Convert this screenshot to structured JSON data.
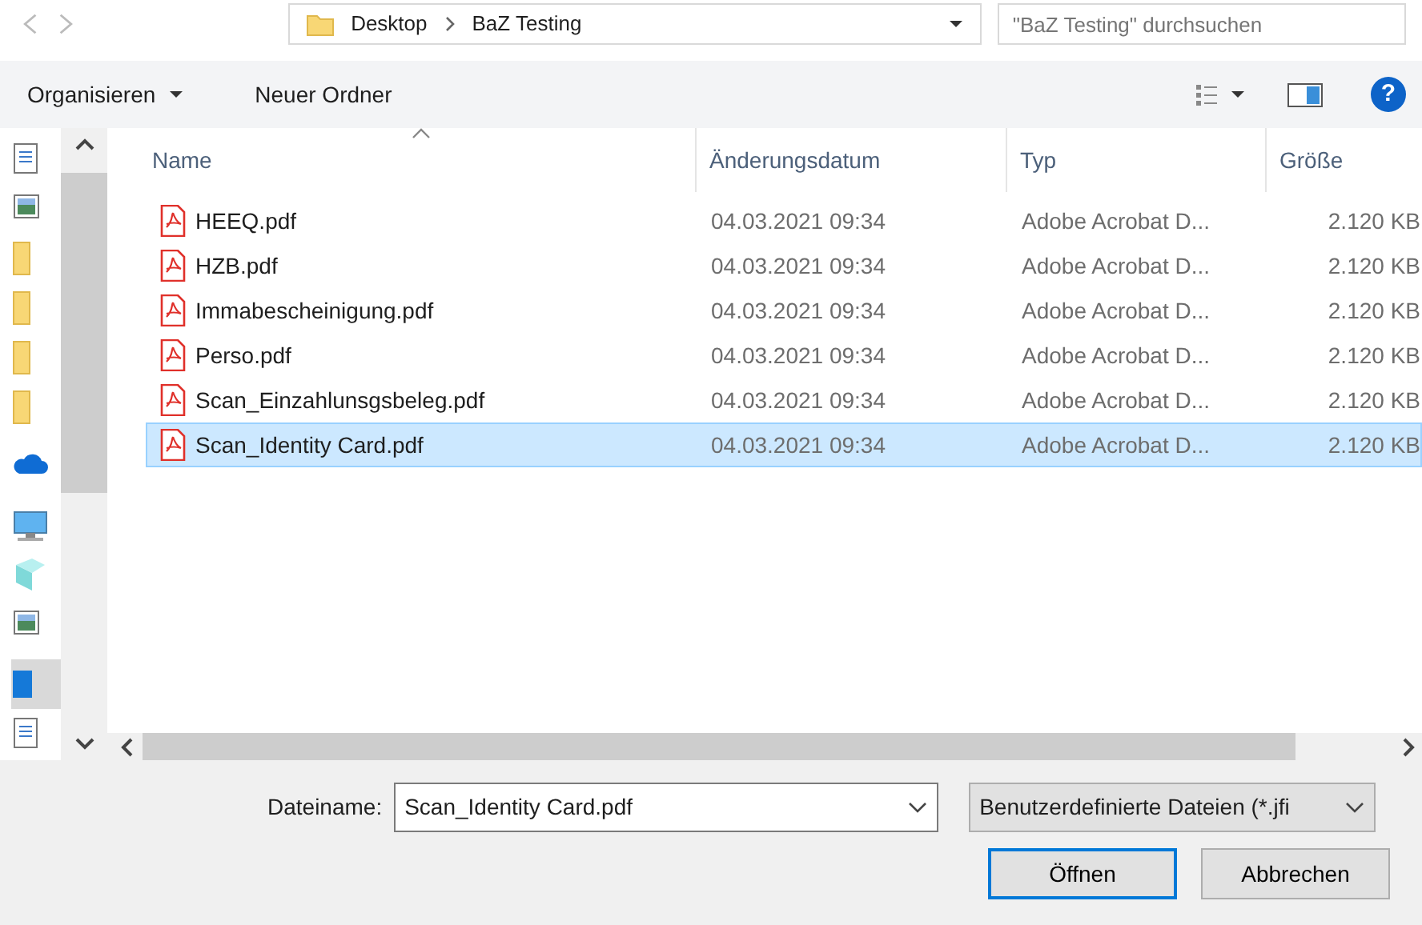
{
  "address_bar": {
    "crumbs": [
      "Desktop",
      "BaZ Testing"
    ]
  },
  "search": {
    "placeholder": "\"BaZ Testing\" durchsuchen"
  },
  "toolbar": {
    "buttons": [
      "Organisieren",
      "Neuer Ordner"
    ],
    "help": "?"
  },
  "nav_items": [
    {
      "kind": "document",
      "selected": false
    },
    {
      "kind": "picture",
      "selected": false
    },
    {
      "kind": "folder",
      "selected": false
    },
    {
      "kind": "folder",
      "selected": false
    },
    {
      "kind": "folder",
      "selected": false
    },
    {
      "kind": "folder",
      "selected": false
    },
    {
      "kind": "cloud",
      "selected": false
    },
    {
      "kind": "computer",
      "selected": false
    },
    {
      "kind": "cube",
      "selected": false
    },
    {
      "kind": "picture",
      "selected": false
    },
    {
      "kind": "desktop",
      "selected": true
    },
    {
      "kind": "document",
      "selected": false
    }
  ],
  "table": {
    "columns": [
      "Name",
      "Änderungsdatum",
      "Typ",
      "Größe"
    ],
    "rows": [
      {
        "name": "HEEQ.pdf",
        "date": "04.03.2021 09:34",
        "type": "Adobe Acrobat D...",
        "size": "2.120 KB",
        "selected": false
      },
      {
        "name": "HZB.pdf",
        "date": "04.03.2021 09:34",
        "type": "Adobe Acrobat D...",
        "size": "2.120 KB",
        "selected": false
      },
      {
        "name": "Immabescheinigung.pdf",
        "date": "04.03.2021 09:34",
        "type": "Adobe Acrobat D...",
        "size": "2.120 KB",
        "selected": false
      },
      {
        "name": "Perso.pdf",
        "date": "04.03.2021 09:34",
        "type": "Adobe Acrobat D...",
        "size": "2.120 KB",
        "selected": false
      },
      {
        "name": "Scan_Einzahlunsgsbeleg.pdf",
        "date": "04.03.2021 09:34",
        "type": "Adobe Acrobat D...",
        "size": "2.120 KB",
        "selected": false
      },
      {
        "name": "Scan_Identity Card.pdf",
        "date": "04.03.2021 09:34",
        "type": "Adobe Acrobat D...",
        "size": "2.120 KB",
        "selected": true
      }
    ]
  },
  "filename": {
    "label": "Dateiname:",
    "value": "Scan_Identity Card.pdf"
  },
  "filetype": {
    "value": "Benutzerdefinierte Dateien (*.jfi"
  },
  "buttons": [
    {
      "label": "Öffnen",
      "default": true
    },
    {
      "label": "Abbrechen",
      "default": false
    }
  ]
}
